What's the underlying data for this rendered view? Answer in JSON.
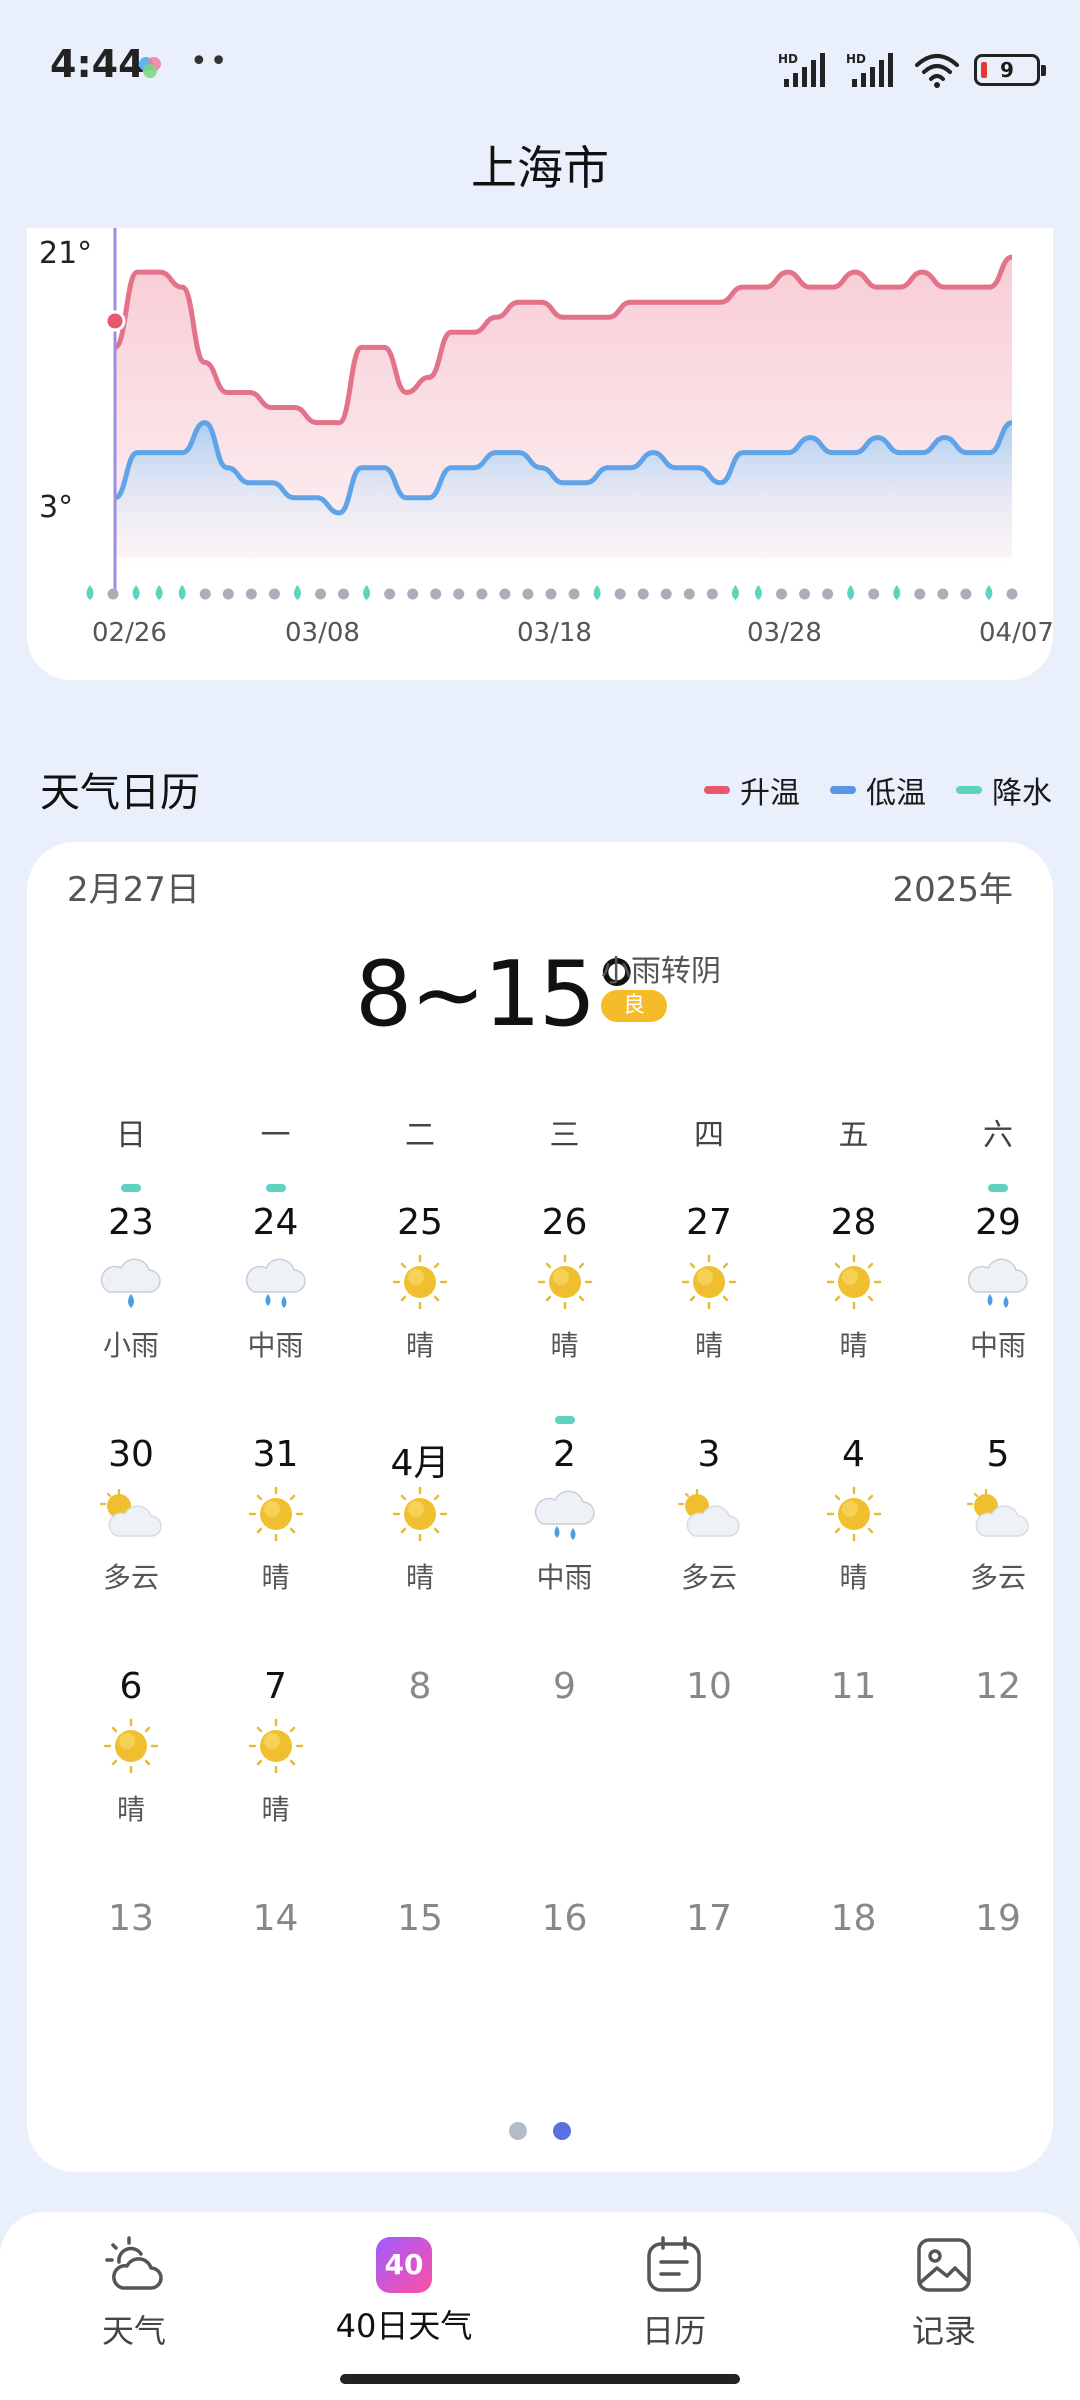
{
  "status_bar": {
    "time": "4:44",
    "dots": "••",
    "network_label": "HD",
    "battery_level": "9"
  },
  "header": {
    "city": "上海市"
  },
  "chart": {
    "y_labels": [
      "21°",
      "3°"
    ],
    "x_labels": [
      "02/26",
      "03/08",
      "03/18",
      "03/28",
      "04/07"
    ],
    "high_color": "#e27388",
    "low_color": "#5fa4e8",
    "rain_color": "#5ed3c0"
  },
  "calendar": {
    "title": "天气日历",
    "legend": [
      {
        "label": "升温",
        "color": "#e8576f"
      },
      {
        "label": "低温",
        "color": "#5a95e6"
      },
      {
        "label": "降水",
        "color": "#5ed3c0"
      }
    ],
    "selected_date": "2月27日",
    "year": "2025年",
    "temp_range": "8~15°",
    "condition": "小雨转阴",
    "aqi": "良",
    "weekdays": [
      "日",
      "一",
      "二",
      "三",
      "四",
      "五",
      "六"
    ],
    "weeks": [
      [
        {
          "day": "23",
          "cond": "小雨",
          "icon": "light-rain",
          "rain": true
        },
        {
          "day": "24",
          "cond": "中雨",
          "icon": "moderate-rain",
          "rain": true
        },
        {
          "day": "25",
          "cond": "晴",
          "icon": "sunny",
          "rain": false
        },
        {
          "day": "26",
          "cond": "晴",
          "icon": "sunny",
          "rain": false
        },
        {
          "day": "27",
          "cond": "晴",
          "icon": "sunny",
          "rain": false
        },
        {
          "day": "28",
          "cond": "晴",
          "icon": "sunny",
          "rain": false
        },
        {
          "day": "29",
          "cond": "中雨",
          "icon": "moderate-rain",
          "rain": true
        }
      ],
      [
        {
          "day": "30",
          "cond": "多云",
          "icon": "cloudy",
          "rain": false
        },
        {
          "day": "31",
          "cond": "晴",
          "icon": "sunny",
          "rain": false
        },
        {
          "day": "4月",
          "cond": "晴",
          "icon": "sunny",
          "rain": false
        },
        {
          "day": "2",
          "cond": "中雨",
          "icon": "moderate-rain",
          "rain": true
        },
        {
          "day": "3",
          "cond": "多云",
          "icon": "cloudy",
          "rain": false
        },
        {
          "day": "4",
          "cond": "晴",
          "icon": "sunny",
          "rain": false
        },
        {
          "day": "5",
          "cond": "多云",
          "icon": "cloudy",
          "rain": false
        }
      ],
      [
        {
          "day": "6",
          "cond": "晴",
          "icon": "sunny",
          "rain": false
        },
        {
          "day": "7",
          "cond": "晴",
          "icon": "sunny",
          "rain": false
        },
        {
          "day": "8",
          "cond": "",
          "icon": "",
          "rain": false
        },
        {
          "day": "9",
          "cond": "",
          "icon": "",
          "rain": false
        },
        {
          "day": "10",
          "cond": "",
          "icon": "",
          "rain": false
        },
        {
          "day": "11",
          "cond": "",
          "icon": "",
          "rain": false
        },
        {
          "day": "12",
          "cond": "",
          "icon": "",
          "rain": false
        }
      ],
      [
        {
          "day": "13",
          "cond": "",
          "icon": "",
          "rain": false
        },
        {
          "day": "14",
          "cond": "",
          "icon": "",
          "rain": false
        },
        {
          "day": "15",
          "cond": "",
          "icon": "",
          "rain": false
        },
        {
          "day": "16",
          "cond": "",
          "icon": "",
          "rain": false
        },
        {
          "day": "17",
          "cond": "",
          "icon": "",
          "rain": false
        },
        {
          "day": "18",
          "cond": "",
          "icon": "",
          "rain": false
        },
        {
          "day": "19",
          "cond": "",
          "icon": "",
          "rain": false
        }
      ]
    ],
    "page_count": 2,
    "active_page": 1
  },
  "bottom_nav": [
    {
      "label": "天气",
      "icon": "cloud-sun-icon",
      "active": false
    },
    {
      "label": "40日天气",
      "icon": "forty-day-badge-icon",
      "badge": "40",
      "active": true
    },
    {
      "label": "日历",
      "icon": "calendar-icon",
      "active": false
    },
    {
      "label": "记录",
      "icon": "image-icon",
      "active": false
    }
  ],
  "chart_data": {
    "type": "line",
    "x": [
      "02/26",
      "02/27",
      "02/28",
      "03/01",
      "03/02",
      "03/03",
      "03/04",
      "03/05",
      "03/06",
      "03/07",
      "03/08",
      "03/09",
      "03/10",
      "03/11",
      "03/12",
      "03/13",
      "03/14",
      "03/15",
      "03/16",
      "03/17",
      "03/18",
      "03/19",
      "03/20",
      "03/21",
      "03/22",
      "03/23",
      "03/24",
      "03/25",
      "03/26",
      "03/27",
      "03/28",
      "03/29",
      "03/30",
      "03/31",
      "04/01",
      "04/02",
      "04/03",
      "04/04",
      "04/05",
      "04/06",
      "04/07"
    ],
    "series": [
      {
        "values": [
          15,
          20,
          20,
          19,
          14,
          12,
          12,
          11,
          11,
          10,
          10,
          15,
          15,
          12,
          13,
          16,
          16,
          17,
          18,
          18,
          17,
          17,
          17,
          18,
          18,
          18,
          18,
          18,
          19,
          19,
          20,
          19,
          19,
          20,
          19,
          19,
          20,
          19,
          19,
          19,
          21
        ]
      },
      {
        "values": [
          5,
          8,
          8,
          8,
          10,
          7,
          6,
          6,
          5,
          5,
          4,
          7,
          7,
          5,
          5,
          7,
          7,
          8,
          8,
          7,
          6,
          6,
          7,
          7,
          8,
          7,
          7,
          6,
          8,
          8,
          8,
          9,
          8,
          8,
          9,
          8,
          8,
          9,
          8,
          8,
          10
        ]
      }
    ],
    "rain_days": [
      "02/26",
      "02/28",
      "03/01",
      "03/02",
      "03/07",
      "03/10",
      "03/20",
      "03/26",
      "03/27",
      "03/31",
      "04/02",
      "04/06"
    ],
    "ylim": [
      1,
      22
    ],
    "y_ticks": [
      "21°",
      "3°"
    ],
    "x_ticks": [
      "02/26",
      "03/08",
      "03/18",
      "03/28",
      "04/07"
    ]
  }
}
